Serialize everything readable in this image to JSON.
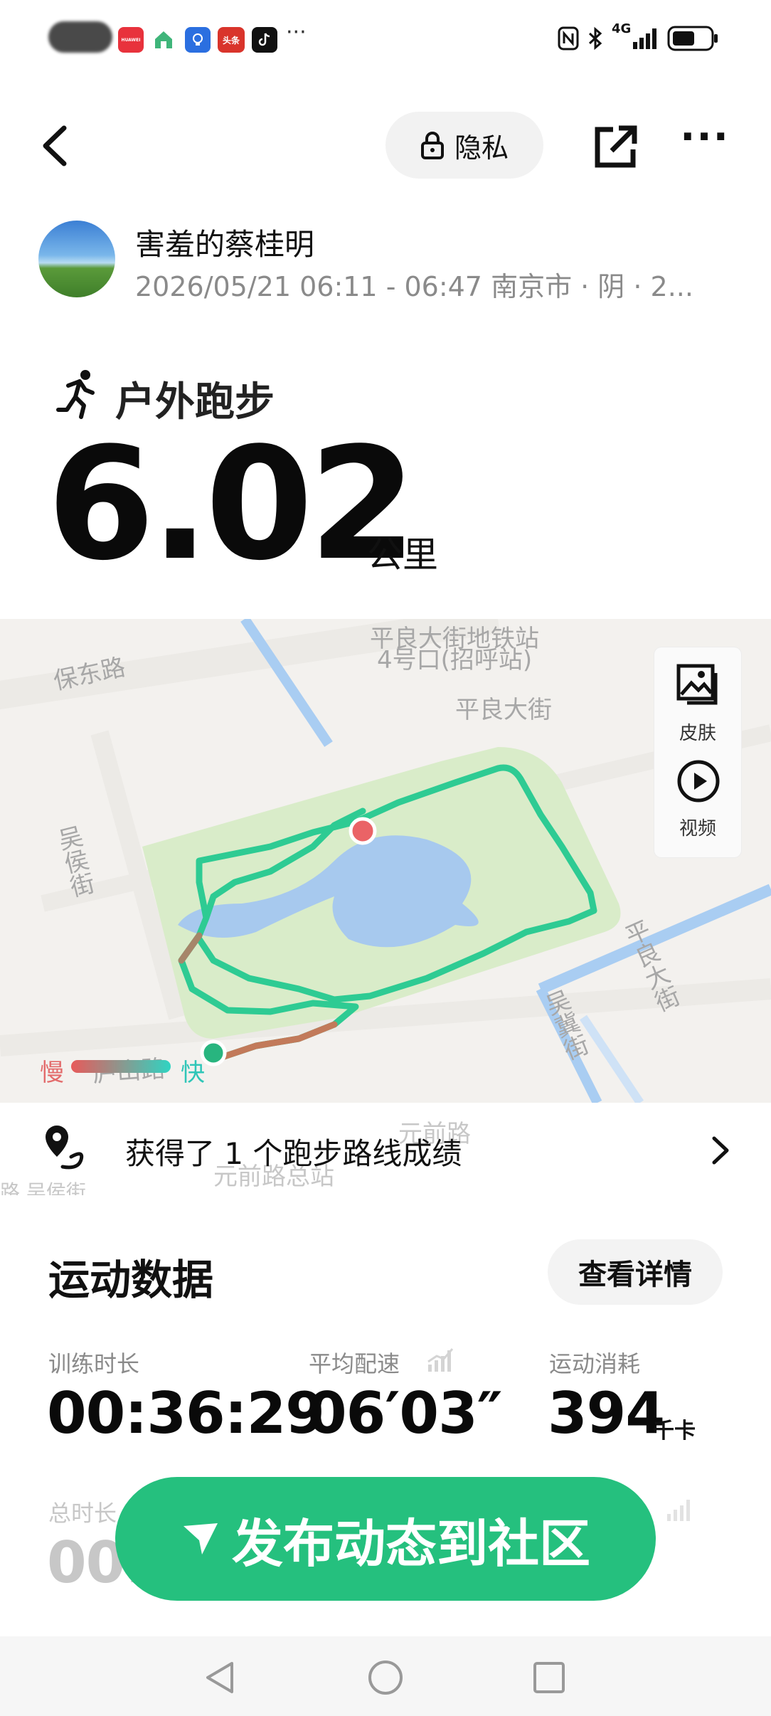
{
  "status_bar": {
    "apps": [
      "HUAWEI",
      "头条"
    ],
    "more": "···",
    "network": "4G",
    "colors": {
      "red_app": "#e8323c",
      "blue_app": "#2b6fe0",
      "toutiao": "#d9342b"
    }
  },
  "header": {
    "privacy_label": "隐私",
    "more_label": "···"
  },
  "user": {
    "name": "害羞的蔡桂明",
    "meta": "2026/05/21 06:11 - 06:47 南京市 · 阴 · 2..."
  },
  "activity": {
    "type": "户外跑步",
    "distance": "6.02",
    "distance_unit": "公里"
  },
  "map": {
    "labels": {
      "metro1": "平良大街地铁站",
      "metro2": "4号口(招呼站)",
      "baodong": "保东路",
      "pingliang1": "平良大街",
      "wuhou": "吴侯街",
      "pingliang2": "平良大街",
      "wuji": "吴冀街",
      "lushan": "庐山路",
      "yuanqian": "元前路",
      "yuanqian_stop": "元前路总站",
      "left_bottom": "路 吴侯街"
    },
    "skin_label": "皮肤",
    "video_label": "视频",
    "legend_slow": "慢",
    "legend_fast": "快"
  },
  "achievement": {
    "text": "获得了 1 个跑步路线成绩"
  },
  "stats": {
    "title": "运动数据",
    "detail_button": "查看详情",
    "items": [
      {
        "label": "训练时长",
        "value": "00:36:29",
        "unit": ""
      },
      {
        "label": "平均配速",
        "value": "06′03″",
        "unit": ""
      },
      {
        "label": "运动消耗",
        "value": "394",
        "unit": "千卡"
      }
    ],
    "second_row_label": "总时长",
    "second_row_value": "00:"
  },
  "publish_button": "发布动态到社区"
}
